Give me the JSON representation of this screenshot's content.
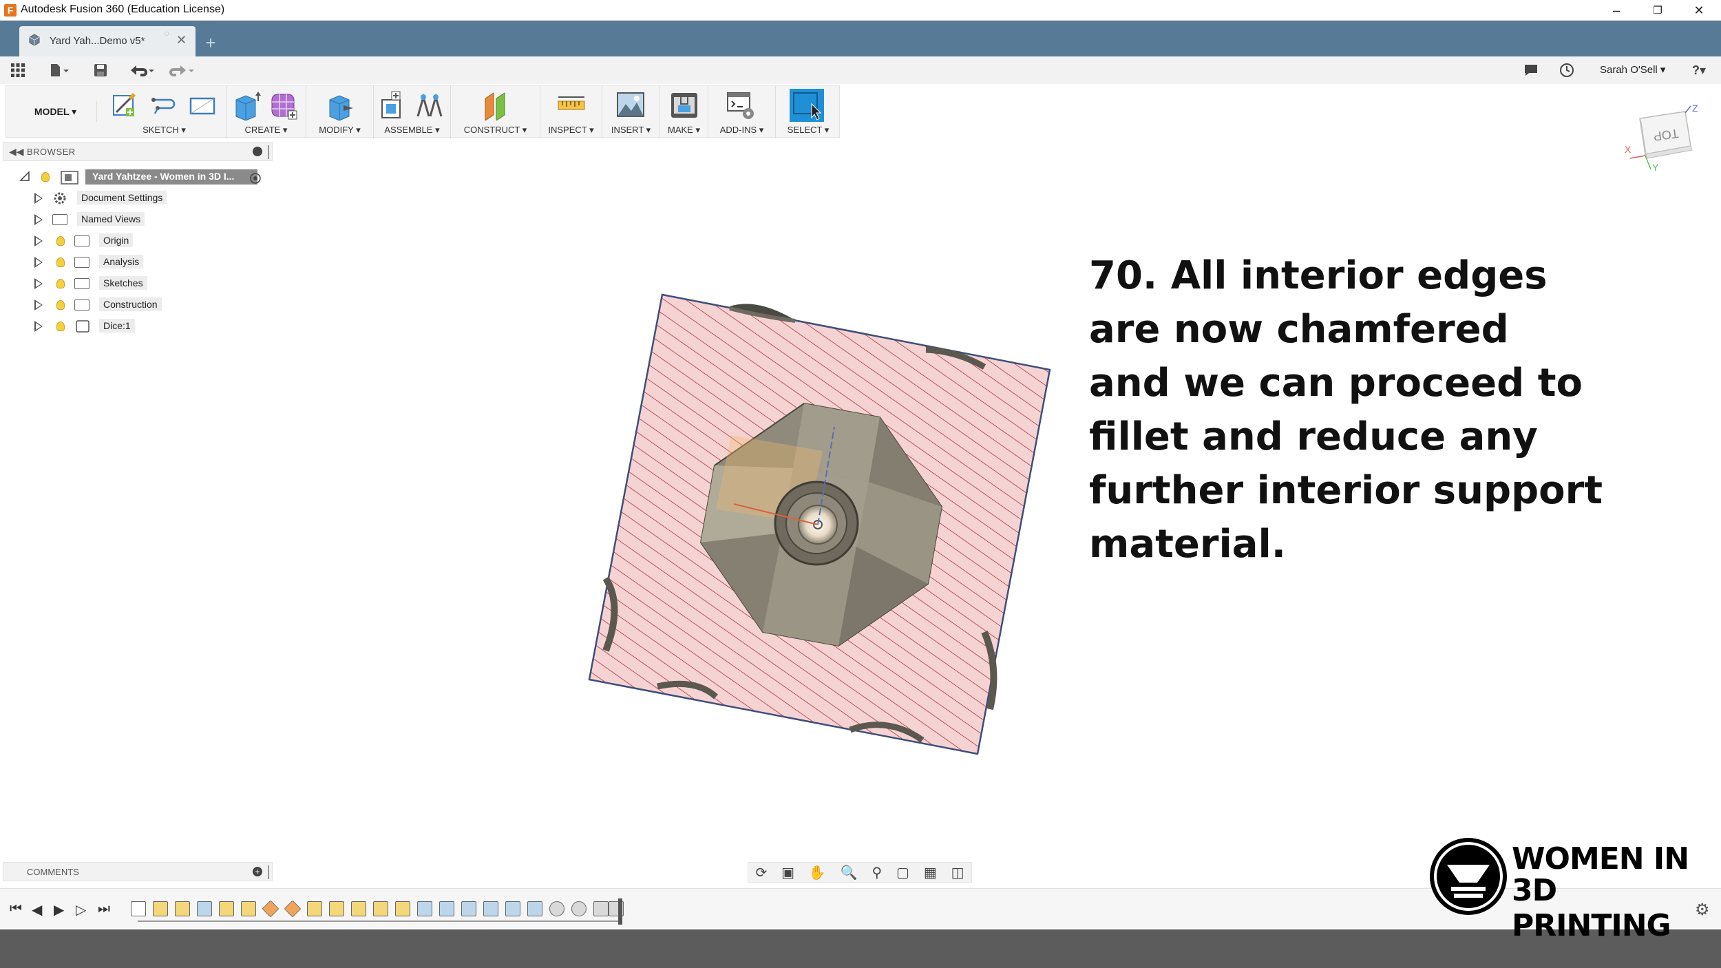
{
  "window": {
    "title": "Autodesk Fusion 360 (Education License)",
    "logo_letter": "F",
    "minimize": "–",
    "restore": "❐",
    "close": "✕"
  },
  "document_tab": {
    "label": "Yard Yah...Demo v5*",
    "close": "✕",
    "unsaved_dot": "○",
    "new_tab": "+"
  },
  "quickbar": {
    "user": "Sarah O'Sell ▾",
    "help": "?▾"
  },
  "toolbar": {
    "workspace": "MODEL ▾",
    "groups": [
      {
        "label": "SKETCH ▾"
      },
      {
        "label": "CREATE ▾"
      },
      {
        "label": "MODIFY ▾"
      },
      {
        "label": "ASSEMBLE ▾"
      },
      {
        "label": "CONSTRUCT ▾"
      },
      {
        "label": "INSPECT ▾"
      },
      {
        "label": "INSERT ▾"
      },
      {
        "label": "MAKE ▾"
      },
      {
        "label": "ADD-INS ▾"
      },
      {
        "label": "SELECT ▾"
      }
    ]
  },
  "browser": {
    "title": "BROWSER",
    "root": "Yard Yahtzee - Women in 3D I...",
    "items": [
      {
        "label": "Document Settings",
        "icon": "gear-icon"
      },
      {
        "label": "Named Views",
        "icon": "folder-icon"
      },
      {
        "label": "Origin",
        "icon": "folder-icon"
      },
      {
        "label": "Analysis",
        "icon": "folder-icon"
      },
      {
        "label": "Sketches",
        "icon": "folder-icon"
      },
      {
        "label": "Construction",
        "icon": "folder-icon"
      },
      {
        "label": "Dice:1",
        "icon": "body-icon"
      }
    ]
  },
  "comments": {
    "label": "COMMENTS"
  },
  "instruction": {
    "lines": [
      "70. All interior edges",
      "are now chamfered",
      "and we can proceed to",
      "fillet and reduce any",
      "further interior support",
      "material."
    ]
  },
  "viewcube": {
    "face": "TOP",
    "axis_x": "X",
    "axis_y": "Y",
    "axis_z": "Z"
  },
  "watermark": {
    "line1": "WOMEN IN",
    "line2": "3D PRINTING"
  },
  "colors": {
    "tabstrip": "#577a96",
    "section_fill": "#f6d3d3",
    "section_hatch": "#c45a5a",
    "select_accent": "#1f8fd6",
    "statusbar": "#5c5c5c"
  }
}
